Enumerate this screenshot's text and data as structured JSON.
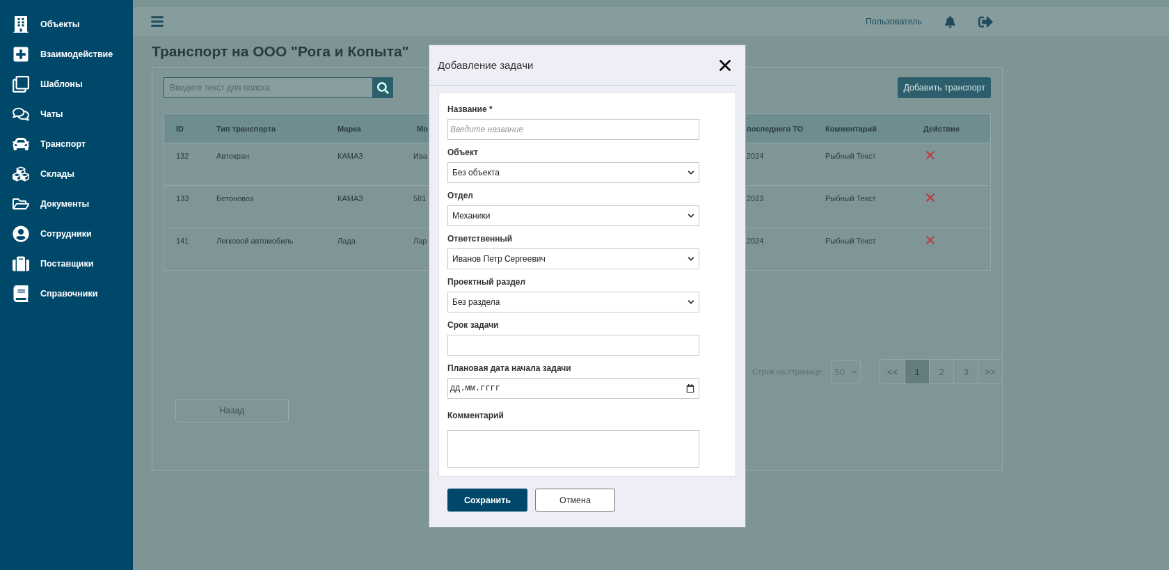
{
  "sidebar": {
    "items": [
      {
        "label": "Объекты"
      },
      {
        "label": "Взаимодействие"
      },
      {
        "label": "Шаблоны"
      },
      {
        "label": "Чаты"
      },
      {
        "label": "Транспорт"
      },
      {
        "label": "Склады"
      },
      {
        "label": "Документы"
      },
      {
        "label": "Сотрудники"
      },
      {
        "label": "Поставщики"
      },
      {
        "label": "Справочники"
      }
    ]
  },
  "header": {
    "user": "Пользователь"
  },
  "page": {
    "title": "Транспорт на ООО \"Рога и Копыта\"",
    "search": {
      "placeholder": "Введите текст для поиска"
    },
    "add_button": "Добавить транспорт",
    "back_button": "Назад"
  },
  "table": {
    "columns": [
      "ID",
      "Тип транспорта",
      "Марка",
      "Мо",
      "последнего ТО",
      "Комментарий",
      "Действие"
    ],
    "rows": [
      [
        "132",
        "Автокран",
        "КАМАЗ",
        "Ива",
        "2024",
        "Рыбный Текст"
      ],
      [
        "133",
        "Бетоновоз",
        "КАМАЗ",
        "581",
        "2023",
        "Рыбный Текст"
      ],
      [
        "141",
        "Легковой автомобиль",
        "Лада",
        "Лар",
        "2024",
        "Рыбный Текст"
      ]
    ]
  },
  "pagination": {
    "rows_label": "Строк на странице:",
    "rows_per_page": "50",
    "pages": [
      {
        "label": "<<",
        "selected": false
      },
      {
        "label": "1",
        "selected": true
      },
      {
        "label": "2",
        "selected": false
      },
      {
        "label": "3",
        "selected": false
      },
      {
        "label": ">>",
        "selected": false
      }
    ]
  },
  "modal": {
    "title": "Добавление задачи",
    "fields": [
      {
        "kind": "text",
        "label": "Название *",
        "placeholder": "Введите название"
      },
      {
        "kind": "select",
        "label": "Объект",
        "value": "Без объекта"
      },
      {
        "kind": "select",
        "label": "Отдел",
        "value": "Механики"
      },
      {
        "kind": "select",
        "label": "Ответственный",
        "value": "Иванов Петр Сергеевич"
      },
      {
        "kind": "select",
        "label": "Проектный раздел",
        "value": "Без раздела"
      },
      {
        "kind": "text",
        "label": "Срок задачи"
      },
      {
        "kind": "date",
        "label": "Плановая дата начала задачи",
        "value": "дд.мм.гггг"
      },
      {
        "kind": "textarea",
        "label": "Комментарий"
      }
    ],
    "save_button": "Сохранить",
    "cancel_button": "Отмена"
  }
}
